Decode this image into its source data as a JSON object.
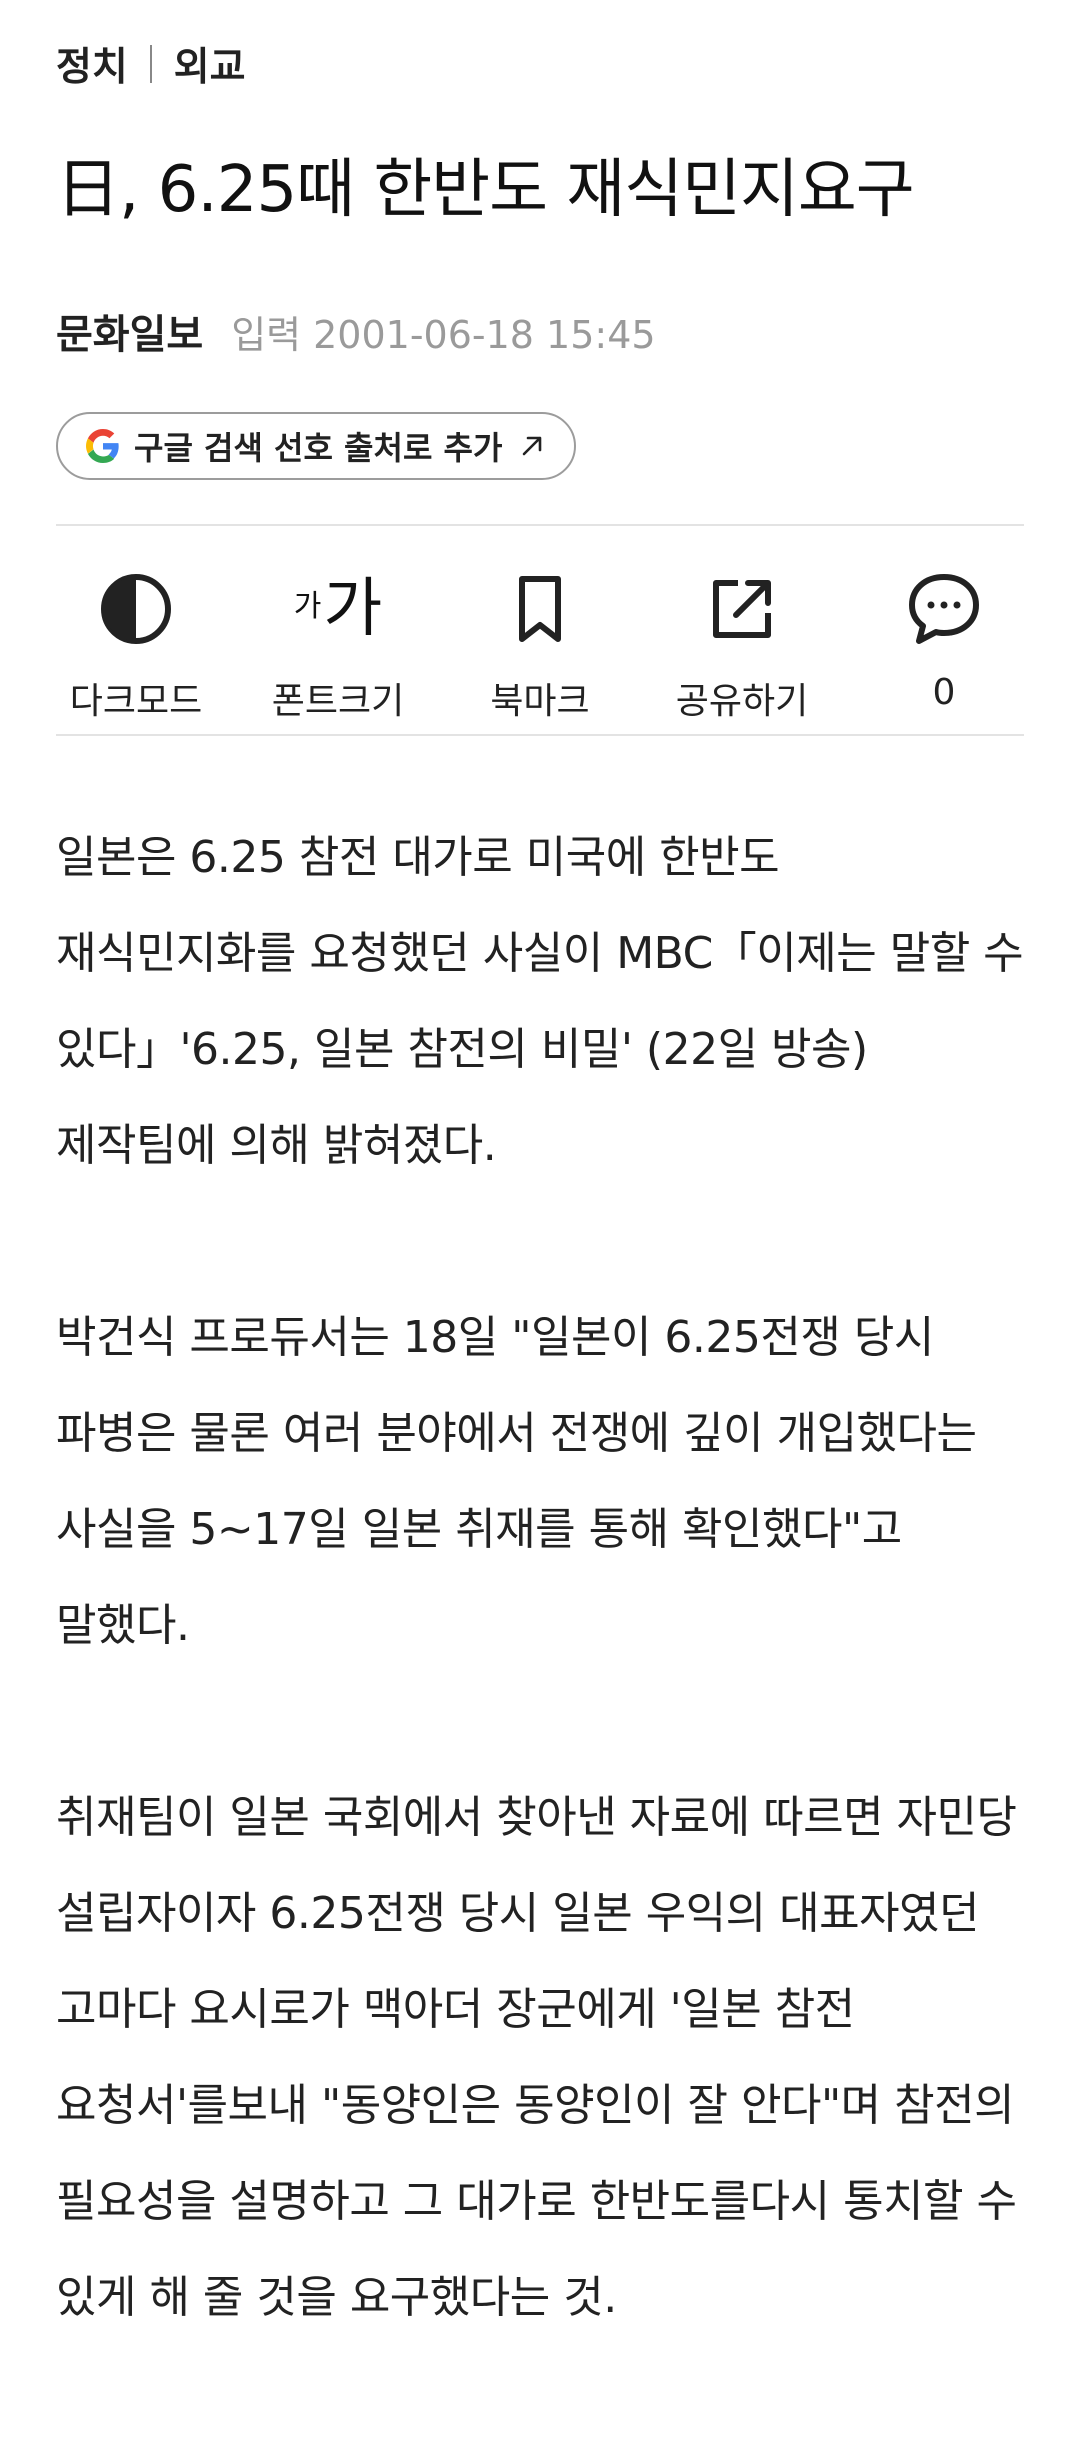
{
  "breadcrumb": {
    "section": "정치",
    "subsection": "외교"
  },
  "article": {
    "title": "日, 6.25때 한반도 재식민지요구",
    "publisher": "문화일보",
    "date_label": "입력",
    "date": "2001-06-18 15:45",
    "paragraphs": [
      "일본은 6.25 참전 대가로 미국에 한반도 재식민지화를 요청했던 사실이 MBC「이제는 말할 수 있다」'6.25, 일본 참전의 비밀' (22일 방송) 제작팀에 의해 밝혀졌다.",
      "박건식 프로듀서는 18일 \"일본이 6.25전쟁 당시 파병은 물론 여러 분야에서 전쟁에 깊이 개입했다는 사실을 5~17일 일본 취재를 통해 확인했다\"고 말했다.",
      "취재팀이 일본 국회에서 찾아낸 자료에 따르면 자민당 설립자이자 6.25전쟁 당시 일본 우익의 대표자였던 고마다 요시로가 맥아더 장군에게 '일본 참전 요청서'를보내 \"동양인은 동양인이 잘 안다\"며 참전의 필요성을 설명하고 그 대가로 한반도를다시 통치할 수 있게 해 줄 것을 요구했다는 것."
    ]
  },
  "google_pill": {
    "label": "구글 검색 선호 출처로 추가",
    "icon": "google-g-icon",
    "arrow_icon": "external-arrow-icon"
  },
  "toolbar": {
    "dark_mode": {
      "label": "다크모드",
      "icon": "half-circle-icon"
    },
    "font_size": {
      "label": "폰트크기",
      "glyph_small": "가",
      "glyph_big": "가",
      "icon": "font-size-icon"
    },
    "bookmark": {
      "label": "북마크",
      "icon": "bookmark-icon"
    },
    "share": {
      "label": "공유하기",
      "icon": "share-icon"
    },
    "comments": {
      "count": "0",
      "icon": "comment-bubble-icon"
    }
  },
  "colors": {
    "text": "#222222",
    "muted": "#9a9a9a",
    "divider": "#e3e3e3",
    "google_blue": "#4285F4",
    "google_red": "#EA4335",
    "google_yellow": "#FBBC05",
    "google_green": "#34A853"
  }
}
